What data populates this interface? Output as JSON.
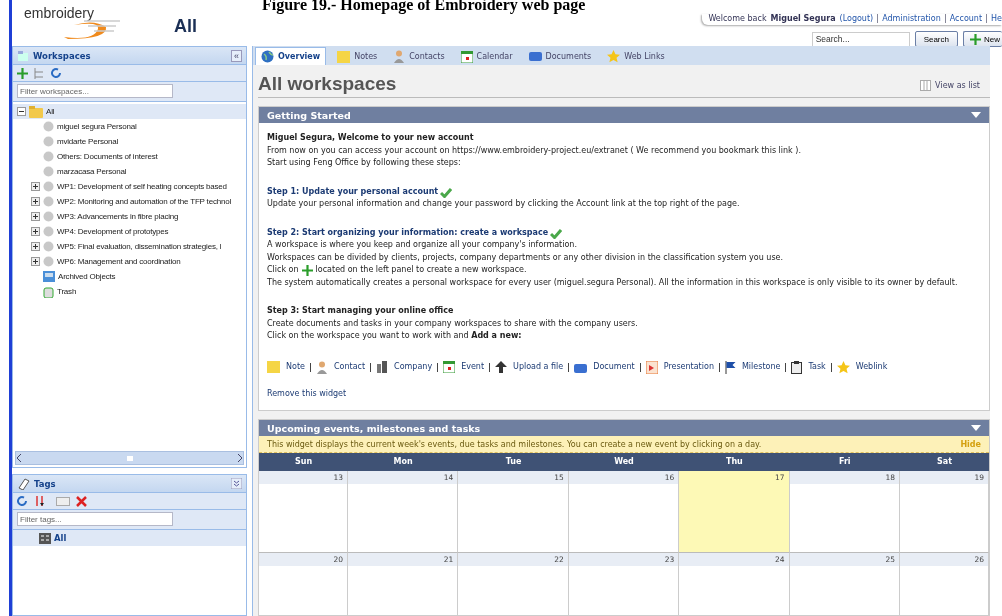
{
  "caption": "Figure 19.- Homepage of Embroidery web page",
  "header": {
    "logo": "embroidery",
    "workspace": "All",
    "welcome": "Welcome back",
    "user": "Miguel Segura",
    "logout": "(Logout)",
    "links": [
      "Administration",
      "Account",
      "He"
    ],
    "search": {
      "placeholder": "Search..."
    },
    "search_button": "Search",
    "new_button": "New"
  },
  "workspaces": {
    "title": "Workspaces",
    "collapse": "«",
    "filter": {
      "placeholder": "Filter workspaces..."
    },
    "tree": [
      {
        "label": "All",
        "kind": "folder",
        "selected": true,
        "children": [
          {
            "label": "miguel segura Personal",
            "kind": "workspace",
            "selected": false
          },
          {
            "label": "mvidarte Personal",
            "kind": "workspace",
            "selected": false
          },
          {
            "label": "Others: Documents of interest",
            "kind": "workspace",
            "selected": false
          },
          {
            "label": "marzacasa Personal",
            "kind": "workspace",
            "selected": false
          },
          {
            "label": "WP1: Development of self heating concepts based",
            "kind": "group",
            "selected": false
          },
          {
            "label": "WP2: Monitoring and automation of the TFP technol",
            "kind": "group",
            "selected": false
          },
          {
            "label": "WP3: Advancements in fibre placing",
            "kind": "group",
            "selected": false
          },
          {
            "label": "WP4: Development of prototypes",
            "kind": "group",
            "selected": false
          },
          {
            "label": "WP5: Final evaluation, dissemination strategies, l",
            "kind": "group",
            "selected": false
          },
          {
            "label": "WP6: Management and coordination",
            "kind": "group",
            "selected": false
          },
          {
            "label": "Archived Objects",
            "kind": "archive",
            "selected": false
          },
          {
            "label": "Trash",
            "kind": "trash",
            "selected": false
          }
        ]
      }
    ]
  },
  "tags": {
    "title": "Tags",
    "filter": {
      "placeholder": "Filter tags..."
    },
    "items": [
      {
        "label": "All",
        "selected": true
      }
    ]
  },
  "tabs": [
    {
      "label": "Overview",
      "kind": "globe",
      "selected": true
    },
    {
      "label": "Notes",
      "kind": "note",
      "selected": false
    },
    {
      "label": "Contacts",
      "kind": "contact",
      "selected": false
    },
    {
      "label": "Calendar",
      "kind": "calendar",
      "selected": false
    },
    {
      "label": "Documents",
      "kind": "document",
      "selected": false
    },
    {
      "label": "Web Links",
      "kind": "star",
      "selected": false
    }
  ],
  "page_title": "All workspaces",
  "view_as_list": "View as list",
  "getting_started": {
    "title": "Getting Started",
    "greeting": "Miguel Segura, Welcome to your new account",
    "intro": [
      "From now on you can access your account on https://www.embroidery-project.eu/extranet ( We recommend you bookmark this link ).",
      "Start using Feng Office by following these steps:"
    ],
    "steps": [
      {
        "title": "Step 1: Update your personal account",
        "done": true,
        "lines": [
          "Update your personal information and change your password by clicking the Account link at the top right of the page."
        ]
      },
      {
        "title": "Step 2: Start organizing your information: create a workspace",
        "done": true,
        "lines": [
          "A workspace is where you keep and organize all your company's information.",
          "Workspaces can be divided by clients, projects, company departments or any other division in the classification system you use."
        ],
        "click_on": "Click on",
        "click_rest": "located on the left panel to create a new workspace.",
        "more": [
          "The system automatically creates a personal workspace for every user (miguel.segura Personal). All the information in this workspace is only visible to its owner by default."
        ]
      },
      {
        "title": "Step 3: Start managing your online office",
        "done": false,
        "lines": [
          "Create documents and tasks in your company workspaces to share with the company users.",
          "Click on the workspace you want to work with and **Add a new:**"
        ]
      }
    ],
    "quick_add": [
      {
        "label": "Note",
        "kind": "note"
      },
      {
        "label": "Contact",
        "kind": "contact"
      },
      {
        "label": "Company",
        "kind": "company"
      },
      {
        "label": "Event",
        "kind": "calendar"
      },
      {
        "label": "Upload a file",
        "kind": "upload"
      },
      {
        "label": "Document",
        "kind": "document"
      },
      {
        "label": "Presentation",
        "kind": "presentation"
      },
      {
        "label": "Milestone",
        "kind": "flag"
      },
      {
        "label": "Task",
        "kind": "task"
      },
      {
        "label": "Weblink",
        "kind": "star"
      }
    ],
    "remove": "Remove this widget"
  },
  "upcoming": {
    "title": "Upcoming events, milestones and tasks",
    "notice": "This widget displays the current week's events, due tasks and milestones. You can create a new event by clicking on a day.",
    "hide": "Hide",
    "days": [
      "Sun",
      "Mon",
      "Tue",
      "Wed",
      "Thu",
      "Fri",
      "Sat"
    ],
    "weeks": [
      [
        {
          "day": "13",
          "today": false
        },
        {
          "day": "14",
          "today": false
        },
        {
          "day": "15",
          "today": false
        },
        {
          "day": "16",
          "today": false
        },
        {
          "day": "17",
          "today": true
        },
        {
          "day": "18",
          "today": false
        },
        {
          "day": "19",
          "today": false
        }
      ],
      [
        {
          "day": "20",
          "today": false
        },
        {
          "day": "21",
          "today": false
        },
        {
          "day": "22",
          "today": false
        },
        {
          "day": "23",
          "today": false
        },
        {
          "day": "24",
          "today": false
        },
        {
          "day": "25",
          "today": false
        },
        {
          "day": "26",
          "today": false
        }
      ]
    ]
  }
}
